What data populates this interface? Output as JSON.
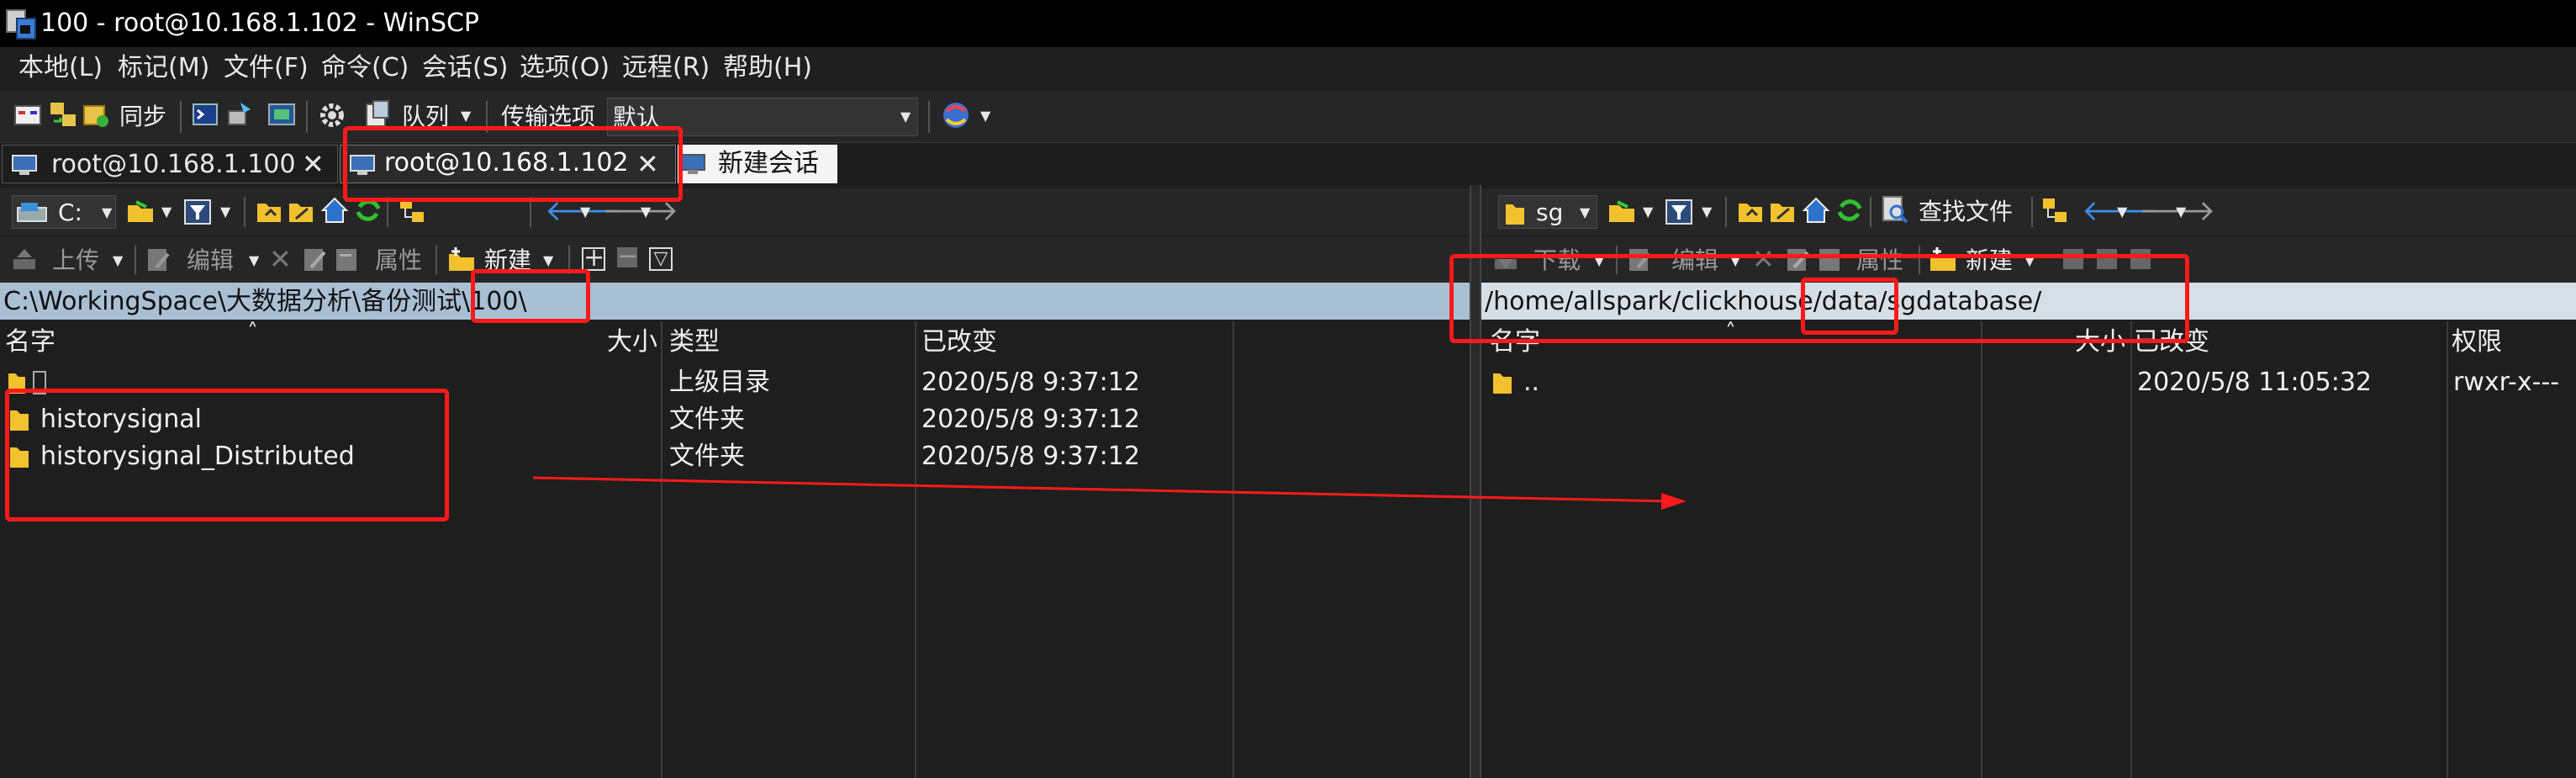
{
  "window": {
    "title": "100 - root@10.168.1.102 - WinSCP"
  },
  "menu": [
    "本地(L)",
    "标记(M)",
    "文件(F)",
    "命令(C)",
    "会话(S)",
    "选项(O)",
    "远程(R)",
    "帮助(H)"
  ],
  "toolbar": {
    "sync_label": "同步",
    "queue_label": "队列",
    "transfer_label": "传输选项",
    "transfer_value": "默认"
  },
  "tabs": [
    {
      "label": "root@10.168.1.100"
    },
    {
      "label": "root@10.168.1.102"
    },
    {
      "label": "新建会话"
    }
  ],
  "left_pane": {
    "drive": "C:",
    "buttons": {
      "upload": "上传",
      "edit": "编辑",
      "properties": "属性",
      "new": "新建"
    },
    "path": "C:\\WorkingSpace\\大数据分析\\备份测试\\100\\",
    "columns": {
      "name": "名字",
      "size": "大小",
      "type": "类型",
      "changed": "已改变"
    },
    "rows": [
      {
        "name": "",
        "type": "上级目录",
        "changed": "2020/5/8  9:37:12"
      },
      {
        "name": "historysignal",
        "type": "文件夹",
        "changed": "2020/5/8  9:37:12"
      },
      {
        "name": "historysignal_Distributed",
        "type": "文件夹",
        "changed": "2020/5/8  9:37:12"
      }
    ]
  },
  "right_pane": {
    "drive": "sg",
    "buttons": {
      "find": "查找文件",
      "download": "下载",
      "edit": "编辑",
      "properties": "属性",
      "new": "新建"
    },
    "path": "/home/allspark/clickhouse/data/sgdatabase/",
    "columns": {
      "name": "名字",
      "size": "大小",
      "changed": "已改变",
      "rights": "权限"
    },
    "rows": [
      {
        "name": "..",
        "changed": "2020/5/8 11:05:32",
        "rights": "rwxr-x---"
      }
    ]
  },
  "colors": {
    "annotation": "#ff1a1a",
    "left_path_bg": "#a9bfd4",
    "folder": "#f2c12e"
  }
}
